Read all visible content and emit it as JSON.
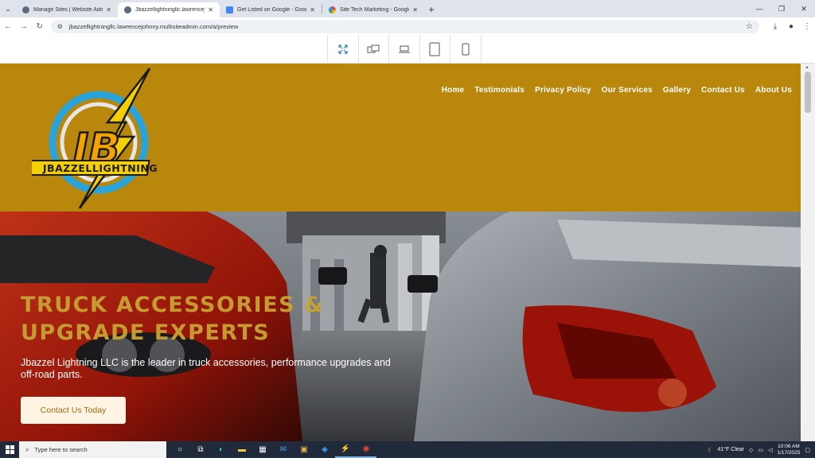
{
  "browser": {
    "tabs": [
      {
        "title": "Manage Sites | Website Admin",
        "active": false,
        "favicon_color": "#5b6a7d"
      },
      {
        "title": "Jbazzellightningllc.lawrencejohnny",
        "active": true,
        "favicon_color": "#5b6a7d"
      },
      {
        "title": "Get Listed on Google - Google",
        "active": false,
        "favicon_color": "#4285f4"
      },
      {
        "title": "Site Tech Marketing - Google S",
        "active": false,
        "favicon_color": "#34a853"
      }
    ],
    "new_tab_label": "+",
    "url": "jbazzellightningllc.lawrencejohnny.multisiteadmin.com/a/preview"
  },
  "preview_toolbar": {
    "buttons": [
      "fit-screen-icon",
      "responsive-icon",
      "laptop-icon",
      "tablet-icon",
      "mobile-icon"
    ]
  },
  "site": {
    "logo_text": "JBAZZELLIGHTNING",
    "logo_initials": "JB",
    "nav": [
      "Home",
      "Testimonials",
      "Privacy Policy",
      "Our Services",
      "Gallery",
      "Contact Us",
      "About Us"
    ],
    "hero": {
      "title_line1": "TRUCK ACCESSORIES &",
      "title_line2": "UPGRADE EXPERTS",
      "subtitle": "Jbazzel Lightning LLC is the leader in truck accessories, performance upgrades and off-road parts.",
      "cta": "Contact Us Today"
    },
    "colors": {
      "header": "#b8870c",
      "title": "#c9a233"
    }
  },
  "taskbar": {
    "search_placeholder": "Type here to search",
    "weather": "41°F  Clear",
    "time": "10:06 AM",
    "date": "1/17/2025"
  }
}
